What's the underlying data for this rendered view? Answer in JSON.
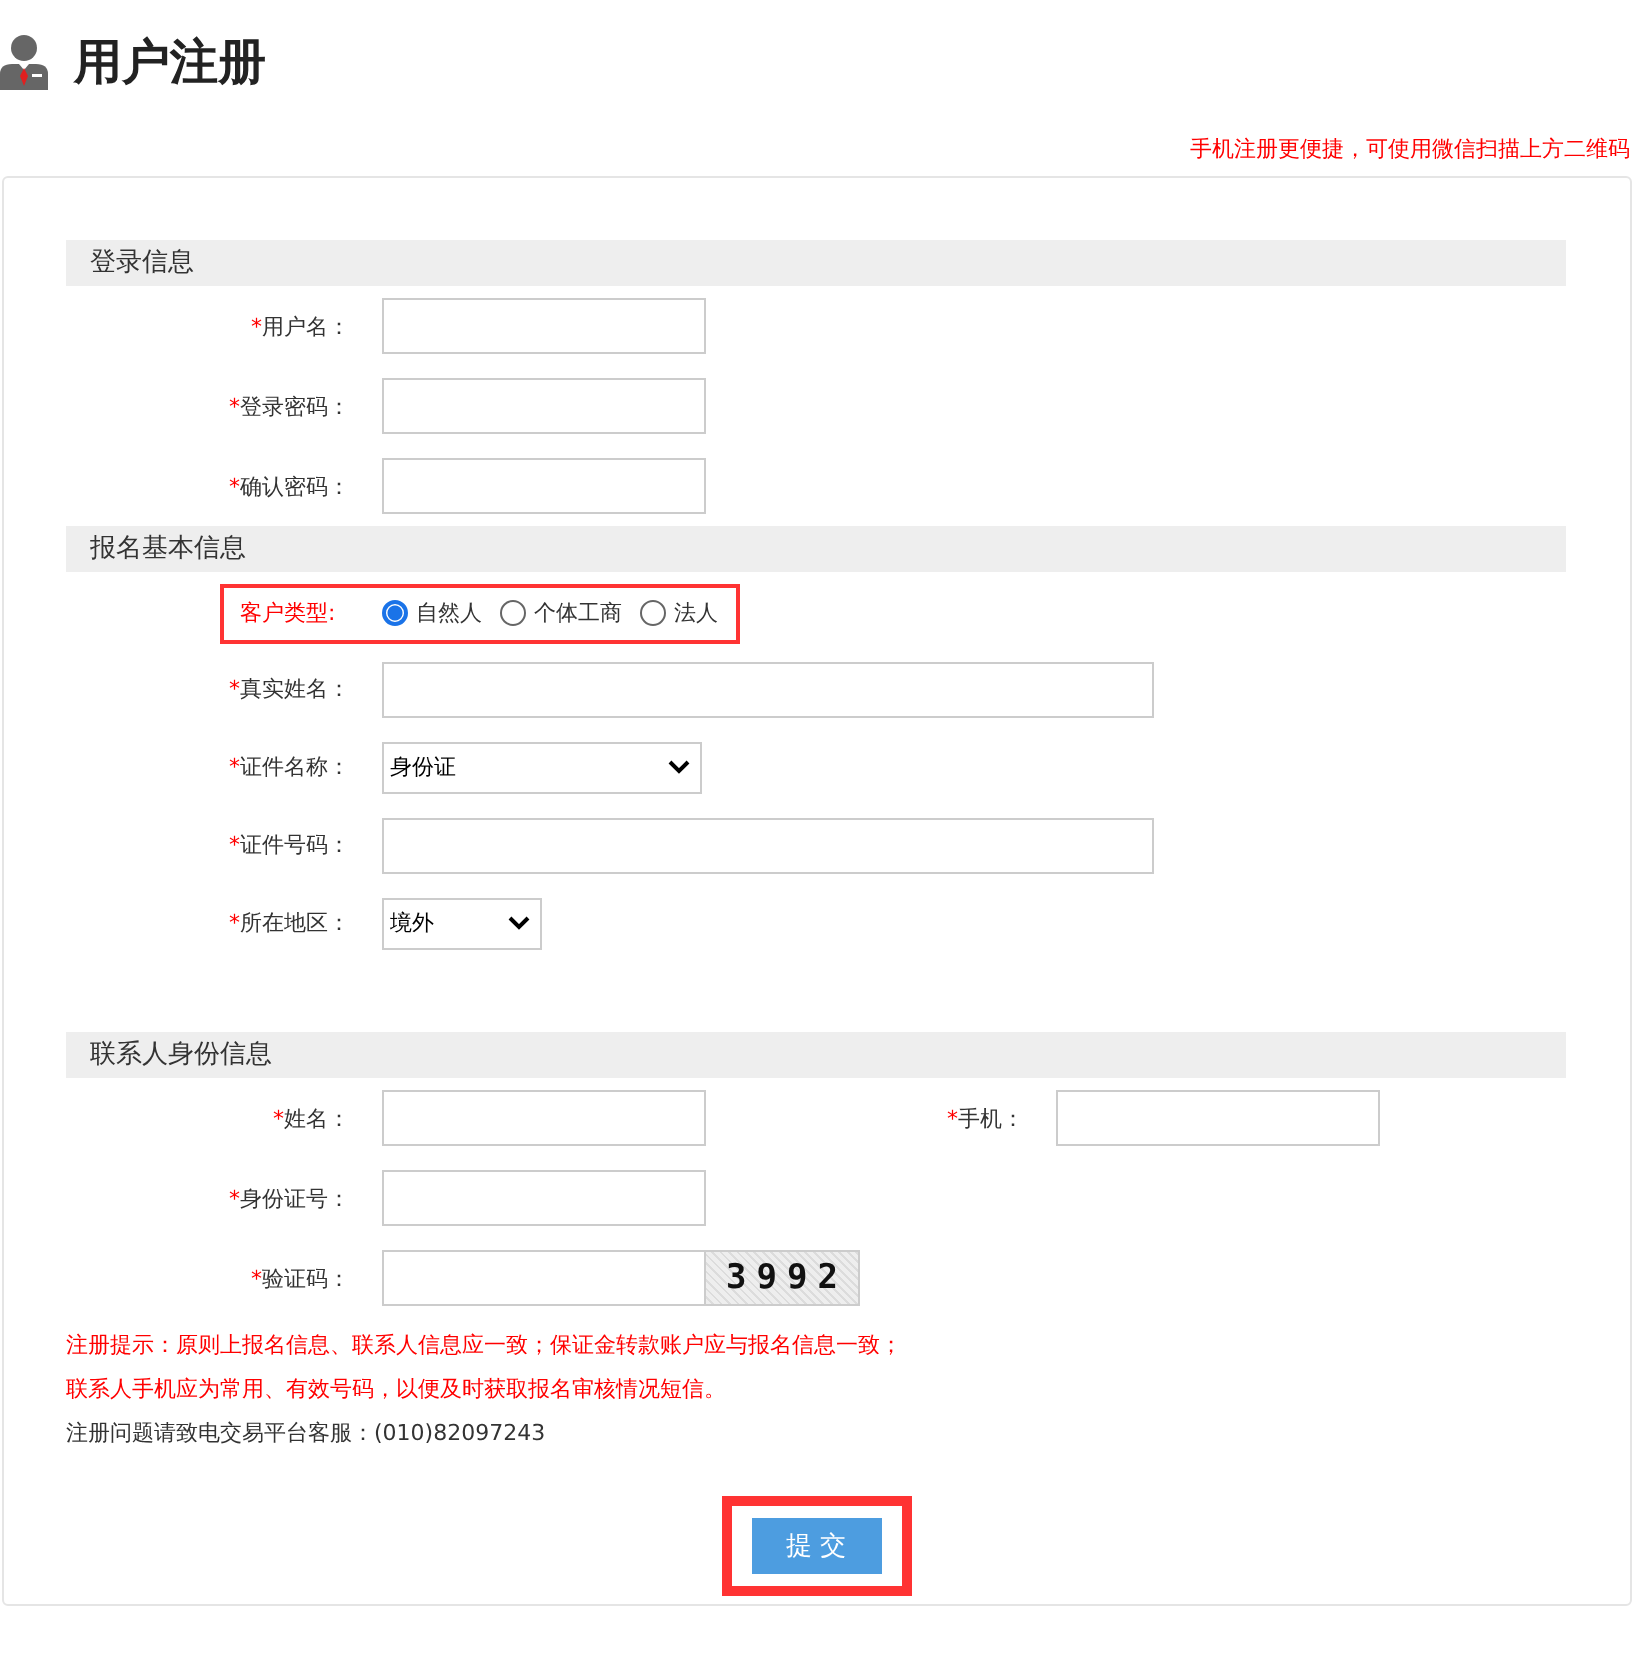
{
  "title": "用户注册",
  "mobile_note": "手机注册更便捷，可使用微信扫描上方二维码",
  "sections": [
    {
      "title": "登录信息",
      "rows": [
        [
          {
            "kind": "input",
            "mark": "*",
            "label": "用户名："
          }
        ],
        [
          {
            "kind": "input",
            "mark": "*",
            "label": "登录密码："
          }
        ],
        [
          {
            "kind": "input",
            "mark": "*",
            "label": "确认密码："
          }
        ]
      ]
    },
    {
      "title": "报名基本信息",
      "rows": [
        [
          {
            "kind": "radio_group",
            "label": "客户类型:",
            "highlighted": true,
            "options": [
              {
                "label": "自然人",
                "selected": true
              },
              {
                "label": "个体工商",
                "selected": false
              },
              {
                "label": "法人",
                "selected": false
              }
            ]
          }
        ],
        [
          {
            "kind": "wide_input",
            "mark": "*",
            "label": "真实姓名："
          }
        ],
        [
          {
            "kind": "wide_select",
            "mark": "*",
            "label": "证件名称：",
            "value": "身份证"
          }
        ],
        [
          {
            "kind": "wide_input",
            "mark": "*",
            "label": "证件号码："
          }
        ],
        [
          {
            "kind": "select",
            "mark": "*",
            "label": "所在地区：",
            "value": "境外"
          }
        ]
      ]
    },
    {
      "title": "联系人身份信息",
      "rows": [
        [
          {
            "kind": "input",
            "mark": "*",
            "label": "姓名："
          },
          {
            "kind": "input",
            "mark": "*",
            "label": "手机："
          }
        ],
        [
          {
            "kind": "input",
            "mark": "*",
            "label": "身份证号："
          }
        ],
        [
          {
            "kind": "captcha_input",
            "mark": "*",
            "label": "验证码：",
            "captcha": "3992"
          }
        ]
      ]
    }
  ],
  "notes": [
    {
      "kind": "warning",
      "text": "注册提示：原则上报名信息、联系人信息应一致；保证金转款账户应与报名信息一致；"
    },
    {
      "kind": "warning",
      "text": "联系人手机应为常用、有效号码，以便及时获取报名审核情况短信。"
    },
    {
      "kind": "info",
      "text": "注册问题请致电交易平台客服：(010)82097243"
    }
  ],
  "submit": {
    "label": "提 交",
    "highlighted": true
  }
}
